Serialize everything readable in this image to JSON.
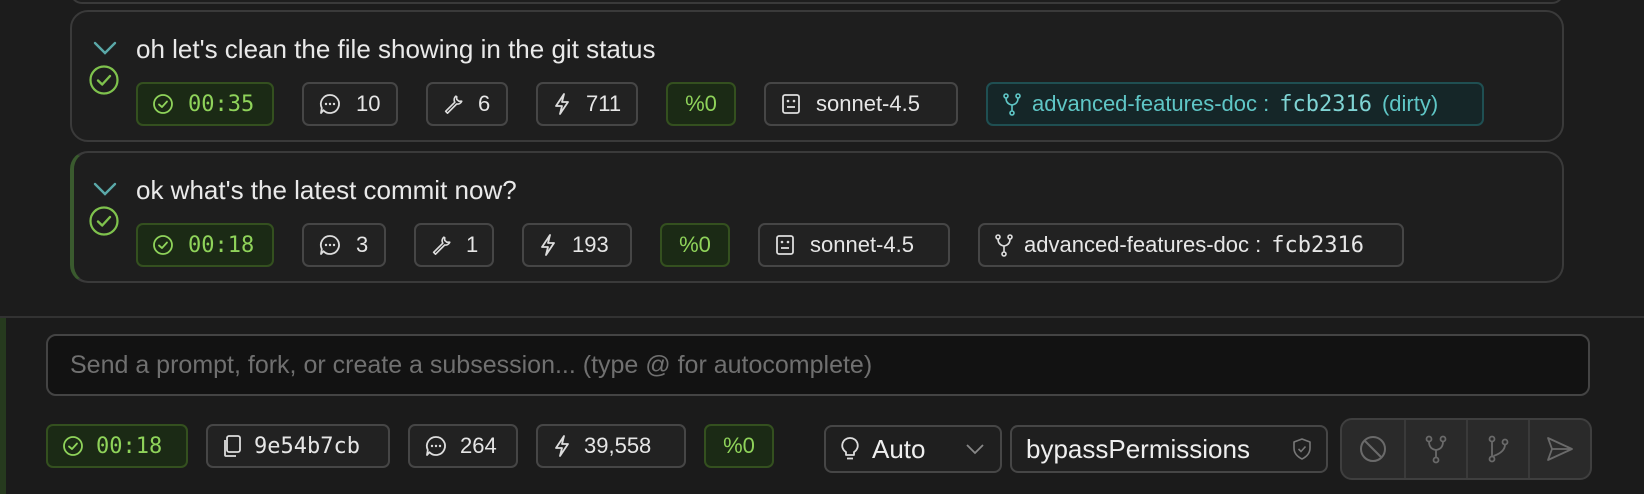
{
  "turns": [
    {
      "prompt": "oh let's clean the file showing in the git status",
      "duration": "00:35",
      "messages": "10",
      "tools": "6",
      "tokens": "711",
      "cost": "%0",
      "model": "sonnet-4.5",
      "branch": "advanced-features-doc :",
      "commit": "fcb2316",
      "dirty": "(dirty)"
    },
    {
      "prompt": "ok what's the latest commit now?",
      "duration": "00:18",
      "messages": "3",
      "tools": "1",
      "tokens": "193",
      "cost": "%0",
      "model": "sonnet-4.5",
      "branch": "advanced-features-doc :",
      "commit": "fcb2316"
    }
  ],
  "composer": {
    "placeholder": "Send a prompt, fork, or create a subsession... (type @ for autocomplete)",
    "duration": "00:18",
    "session_id": "9e54b7cb",
    "messages": "264",
    "tokens": "39,558",
    "cost": "%0",
    "effort": "Auto",
    "permission_mode": "bypassPermissions"
  },
  "colors": {
    "accent_green": "#8fd35a",
    "accent_teal": "#5fc6c6",
    "chevron": "#5aa8a8"
  },
  "icons": [
    "chevron-down-icon",
    "check-circle-icon",
    "chat-bubble-icon",
    "wrench-icon",
    "bolt-icon",
    "robot-icon",
    "git-branch-icon",
    "copy-icon",
    "lightbulb-icon",
    "shield-check-icon",
    "stop-icon",
    "fork-icon",
    "subsession-icon",
    "send-icon"
  ]
}
